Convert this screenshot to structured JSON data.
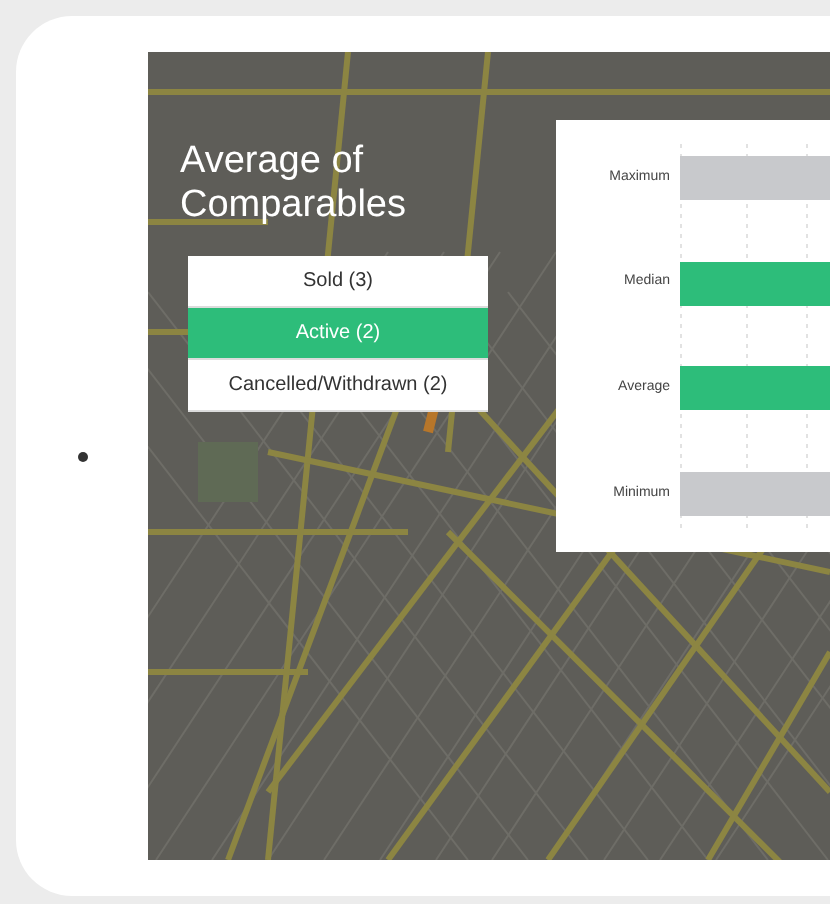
{
  "panel": {
    "title": "Average of Comparables"
  },
  "filters": [
    {
      "label": "Sold (3)",
      "selected": false
    },
    {
      "label": "Active (2)",
      "selected": true
    },
    {
      "label": "Cancelled/Withdrawn (2)",
      "selected": false
    }
  ],
  "chart": {
    "rows": [
      {
        "label": "Maximum",
        "color": "#c8c9cc"
      },
      {
        "label": "Median",
        "color": "#2dbd7a"
      },
      {
        "label": "Average",
        "color": "#2dbd7a"
      },
      {
        "label": "Minimum",
        "color": "#c8c9cc"
      }
    ]
  }
}
